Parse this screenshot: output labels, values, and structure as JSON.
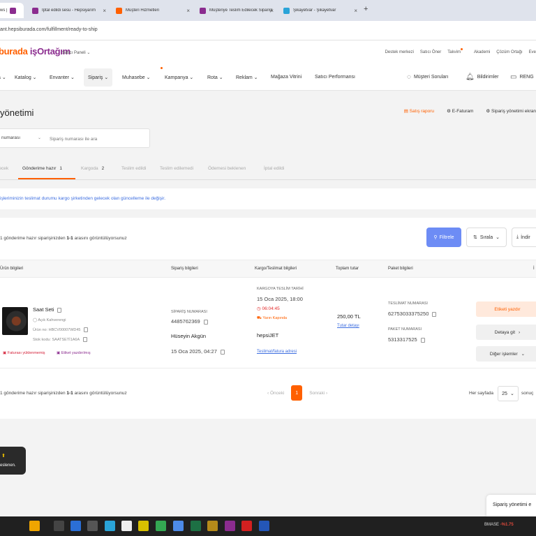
{
  "browser": {
    "tabs": [
      {
        "label": "ws | S.D",
        "color": "#8b2c8f",
        "close": "×"
      },
      {
        "label": "İptal edildi sesu - Hepsiyarım",
        "color": "#8b2c8f",
        "close": "×"
      },
      {
        "label": "Müşteri Hizmetleri",
        "color": "#ff6000",
        "close": "×"
      },
      {
        "label": "Müşteriye Teslim Edilecek Siparişler",
        "color": "#8b2c8f",
        "close": "×"
      },
      {
        "label": "Şikayetvar - Şikayetvar",
        "color": "#2aa4d8",
        "close": "×"
      }
    ],
    "new_tab": "+",
    "url": "ant.hepsiburada.com/fulfillment/ready-to-ship"
  },
  "site": {
    "logo_a": "burada ",
    "logo_b": "işOrtağım",
    "seller_panel": "Satıcı Paneli ⌄",
    "top_links": [
      "Destek merkezi",
      "Satıcı Öner",
      "Takvim",
      "Akademi",
      "Çözüm Ortağı",
      "Eve"
    ],
    "nav": [
      "Katalog ⌄",
      "Envanter ⌄",
      "Sipariş ⌄",
      "Muhasebe ⌄",
      "Kampanya ⌄",
      "Rota ⌄",
      "Reklam ⌄",
      "Mağaza Vitrini",
      "Satıcı Performansı"
    ],
    "nav_right": {
      "questions": "Müşteri Soruları",
      "notifications": "Bildirimler",
      "more": "RENG"
    },
    "icons": {
      "questions": "question-bubble-icon",
      "bell": "bell-icon"
    }
  },
  "page": {
    "title": "yönetimi",
    "actions": {
      "report": "Satış raporu",
      "einvoice": "E-Faturam",
      "order_screen": "Sipariş yönetimi ekran"
    },
    "search": {
      "select": "numarası",
      "arrow": "⌄",
      "placeholder": "Sipariş numarası ile ara"
    },
    "tabs": [
      {
        "label": "lecek",
        "count": ""
      },
      {
        "label": "Gönderime hazır",
        "count": "1"
      },
      {
        "label": "Kargoda",
        "count": "2"
      },
      {
        "label": "Teslim edildi",
        "count": ""
      },
      {
        "label": "Teslim edilemedi",
        "count": ""
      },
      {
        "label": "Ödemesi beklenen",
        "count": ""
      },
      {
        "label": "İptal edildi",
        "count": ""
      }
    ],
    "notice": "işleriminizin teslimat durumu kargo şirketinden gelecek olan güncelleme ile değişir.",
    "result_info": {
      "pre": "1 gönderime hazır siparişinizden ",
      "bold": "1-1",
      "post": " arasını görüntülüyorsunuz"
    },
    "buttons": {
      "filter": "Filtrele",
      "sort": "Sırala",
      "download": "İndir"
    },
    "table_headers": [
      "Ürün bilgileri",
      "Sipariş bilgileri",
      "Kargo/Teslimat bilgileri",
      "Toplam tutar",
      "Paket bilgileri",
      "İ"
    ],
    "row": {
      "product_name": "Saat Seti",
      "variant": "Açık Kahverengi",
      "product_no": "Ürün no: HBCV00007WD45",
      "stock_code": "Stok kodu: SAATSETİ1A6A",
      "badge_invoice": "Faturası yüklenmemiş",
      "badge_label": "Etiket yazdırılmış",
      "order_label": "SİPARİŞ NUMARASI",
      "order_no": "4485762369",
      "customer": "Hüseyin Akgün",
      "order_date": "15 Oca 2025, 04:27",
      "cargo_label": "KARGOYA TESLİM TARİHİ",
      "cargo_date": "15 Oca 2025, 18:00",
      "countdown": "06:04:45",
      "cargo_tag": "Yarın Kapında",
      "carrier": "hepsiJET",
      "address_link": "Teslimat/fatura adresi",
      "total": "250,00 TL",
      "total_detail": "Tutar detayı",
      "delivery_label": "TESLİMAT NUMARASI",
      "delivery_no": "62753033375250",
      "package_label": "PAKET NUMARASI",
      "package_no": "5313317525",
      "btn_print": "Etiketi yazdır",
      "btn_detail": "Detaya git",
      "btn_other": "Diğer işlemler"
    },
    "pager": {
      "prev": "‹  Önceki",
      "current": "1",
      "next": "Sonraki  ›",
      "per_page_label": "Her sayfada",
      "per_page": "25",
      "per_page_after": "sonuç"
    }
  },
  "toast": {
    "icon": "⬆",
    "text": "eslenen."
  },
  "chat": {
    "label": "Sipariş yönetimi e"
  },
  "taskbar": {
    "icons": [
      "#f0a500",
      "#444",
      "#2b6fd6",
      "#555",
      "#2aa4d8",
      "#eee",
      "#d8c000",
      "#34a853",
      "#4d8ae8",
      "#1d7044",
      "#b58a1a",
      "#8b2c8f",
      "#d42020",
      "#2456b8"
    ],
    "tray_ticker": "BMASE",
    "tray_value": "-%1.75"
  }
}
